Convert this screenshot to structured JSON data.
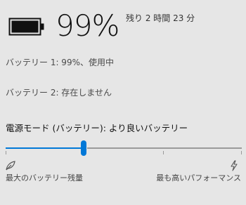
{
  "battery": {
    "icon": "battery-full-icon",
    "percent_text": "99%",
    "charge_fraction": 0.99,
    "remaining": "残り 2 時間 23 分"
  },
  "status": {
    "battery1": "バッテリー 1: 99%、使用中",
    "battery2": "バッテリー 2: 存在しません"
  },
  "power_mode": {
    "title": "電源モード (バッテリー): より良いバッテリー",
    "levels": 4,
    "selected_index": 1,
    "left_icon": "leaf-icon",
    "right_icon": "lightning-icon",
    "left_label": "最大のバッテリー残量",
    "right_label": "最も高いパフォーマンス",
    "accent_color": "#0078d7"
  }
}
